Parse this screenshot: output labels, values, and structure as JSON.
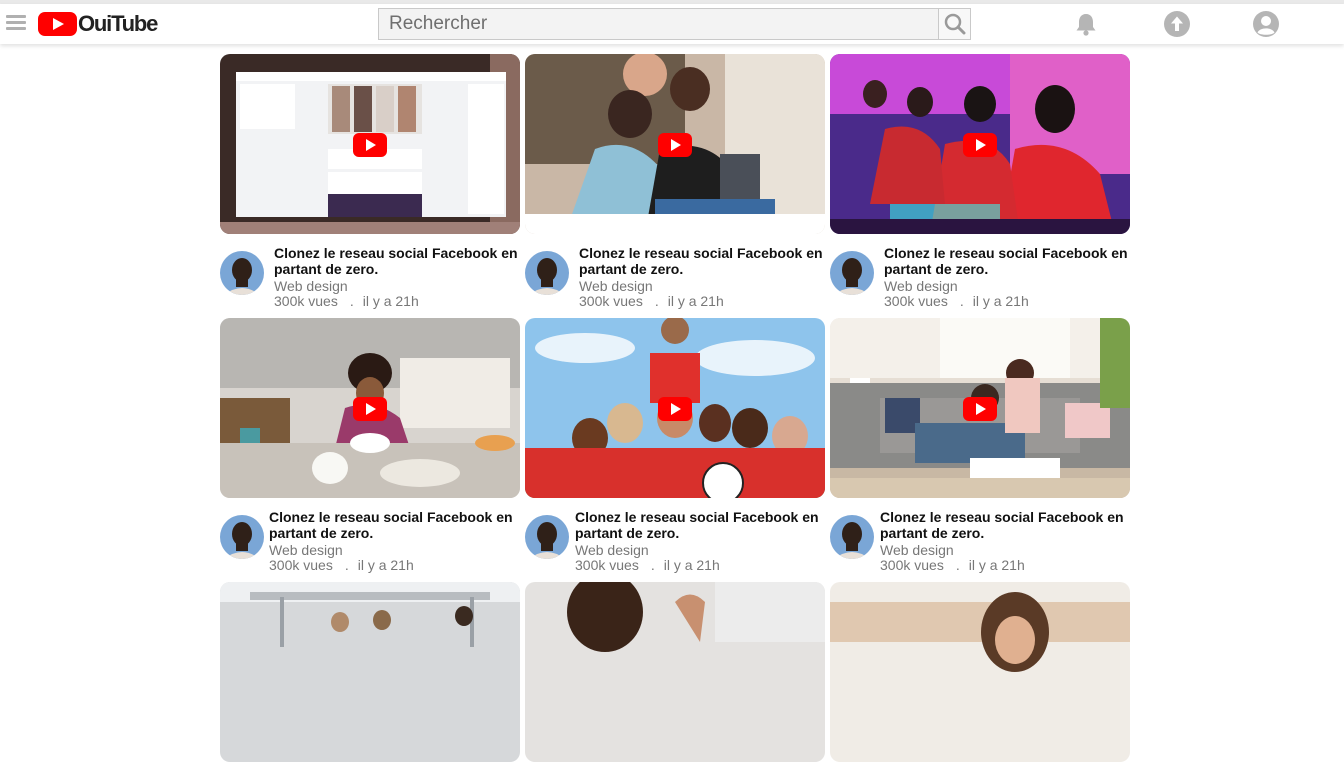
{
  "app": {
    "logo_text": "OuiTube"
  },
  "header": {
    "search_placeholder": "Rechercher",
    "icons": [
      "menu-icon",
      "search-icon",
      "bell-icon",
      "upload-icon",
      "account-icon"
    ]
  },
  "colors": {
    "brand_red": "#ff0000",
    "icon_grey": "#b5b5b5",
    "text_meta": "#777777"
  },
  "videos": [
    {
      "title": "Clonez le reseau social Facebook en partant de zero.",
      "channel": "Web design",
      "views": "300k vues",
      "dot": ".",
      "age": "il y a 21h"
    },
    {
      "title": "Clonez le reseau social Facebook en partant de zero.",
      "channel": "Web design",
      "views": "300k vues",
      "dot": ".",
      "age": "il y a 21h"
    },
    {
      "title": "Clonez le reseau social Facebook en partant de zero.",
      "channel": "Web design",
      "views": "300k vues",
      "dot": ".",
      "age": "il y a 21h"
    },
    {
      "title": "Clonez le reseau social Facebook en partant de zero.",
      "channel": "Web design",
      "views": "300k vues",
      "dot": ".",
      "age": "il y a 21h"
    },
    {
      "title": "Clonez le reseau social Facebook en partant de zero.",
      "channel": "Web design",
      "views": "300k vues",
      "dot": ".",
      "age": "il y a 21h"
    },
    {
      "title": "Clonez le reseau social Facebook en partant de zero.",
      "channel": "Web design",
      "views": "300k vues",
      "dot": ".",
      "age": "il y a 21h"
    }
  ]
}
